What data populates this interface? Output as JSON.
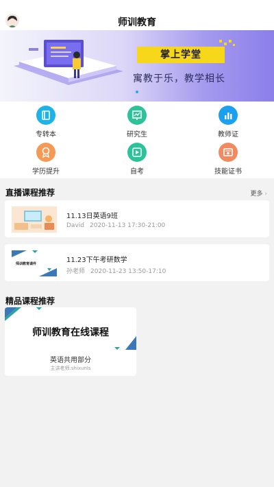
{
  "header": {
    "title": "师训教育"
  },
  "banner": {
    "tag": "掌上学堂",
    "slogan": "寓教于乐，教学相长"
  },
  "categories": [
    {
      "label": "专转本",
      "color": "#1db3e8",
      "icon": "book-icon"
    },
    {
      "label": "研究生",
      "color": "#2cc39a",
      "icon": "chart-board-icon"
    },
    {
      "label": "教师证",
      "color": "#1aa0ee",
      "icon": "bar-chart-icon"
    },
    {
      "label": "学历提升",
      "color": "#f59a55",
      "icon": "medal-icon"
    },
    {
      "label": "自考",
      "color": "#2cc39a",
      "icon": "play-icon"
    },
    {
      "label": "技能证书",
      "color": "#f08a60",
      "icon": "certificate-icon"
    }
  ],
  "live_section": {
    "title": "直播课程推荐",
    "more": "更多",
    "courses": [
      {
        "name": "11.13日英语9班",
        "teacher": "David",
        "time": "2020-11-13 17:30-21:00"
      },
      {
        "name": "11.23下午考研数学",
        "teacher": "孙老师",
        "time": "2020-11-23 13:50-17:10",
        "thumb_caption": "师训教育课件"
      }
    ]
  },
  "premium_section": {
    "title": "精品课程推荐",
    "card": {
      "title": "师训教育在线课程",
      "subtitle": "英语共用部分",
      "teacher": "主讲老师:shixunls"
    }
  }
}
